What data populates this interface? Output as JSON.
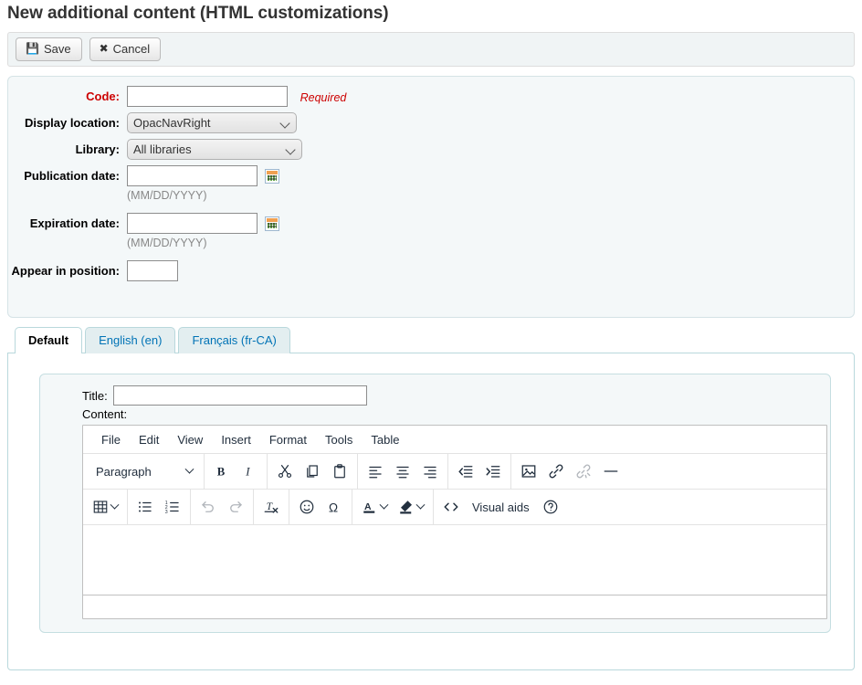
{
  "page": {
    "title": "New additional content (HTML customizations)"
  },
  "toolbar": {
    "save_label": "Save",
    "save_icon": "floppy-disk-icon",
    "cancel_label": "Cancel",
    "cancel_icon": "x-mark-icon"
  },
  "form": {
    "code": {
      "label": "Code:",
      "value": "",
      "placeholder": "",
      "required_note": "Required",
      "required_color": "#cc0000"
    },
    "display_location": {
      "label": "Display location:",
      "selected": "OpacNavRight",
      "options": [
        "OpacNavRight"
      ]
    },
    "library": {
      "label": "Library:",
      "selected": "All libraries",
      "options": [
        "All libraries"
      ]
    },
    "publication_date": {
      "label": "Publication date:",
      "value": "",
      "hint": "(MM/DD/YYYY)",
      "calendar_icon": "calendar-icon"
    },
    "expiration_date": {
      "label": "Expiration date:",
      "value": "",
      "hint": "(MM/DD/YYYY)",
      "calendar_icon": "calendar-icon"
    },
    "position": {
      "label": "Appear in position:",
      "value": ""
    }
  },
  "tabs": [
    {
      "label": "Default",
      "active": true
    },
    {
      "label": "English (en)",
      "active": false
    },
    {
      "label": "Français (fr-CA)",
      "active": false
    }
  ],
  "editor_pane": {
    "title_label": "Title:",
    "title_value": "",
    "content_label": "Content:"
  },
  "tinymce": {
    "menubar": [
      "File",
      "Edit",
      "View",
      "Insert",
      "Format",
      "Tools",
      "Table"
    ],
    "format_select": "Paragraph",
    "visual_aids_label": "Visual aids",
    "row1_buttons": [
      "bold-icon",
      "italic-icon",
      "cut-icon",
      "copy-icon",
      "paste-icon",
      "align-left-icon",
      "align-center-icon",
      "align-right-icon",
      "outdent-icon",
      "indent-icon",
      "insert-image-icon",
      "insert-link-icon",
      "unlink-icon",
      "horizontal-rule-icon"
    ],
    "row2_buttons": [
      "table-icon",
      "bullet-list-icon",
      "numbered-list-icon",
      "undo-icon",
      "redo-icon",
      "clear-formatting-icon",
      "emoticon-icon",
      "special-character-icon",
      "text-color-icon",
      "background-color-icon",
      "source-code-icon",
      "help-icon"
    ],
    "content": ""
  }
}
